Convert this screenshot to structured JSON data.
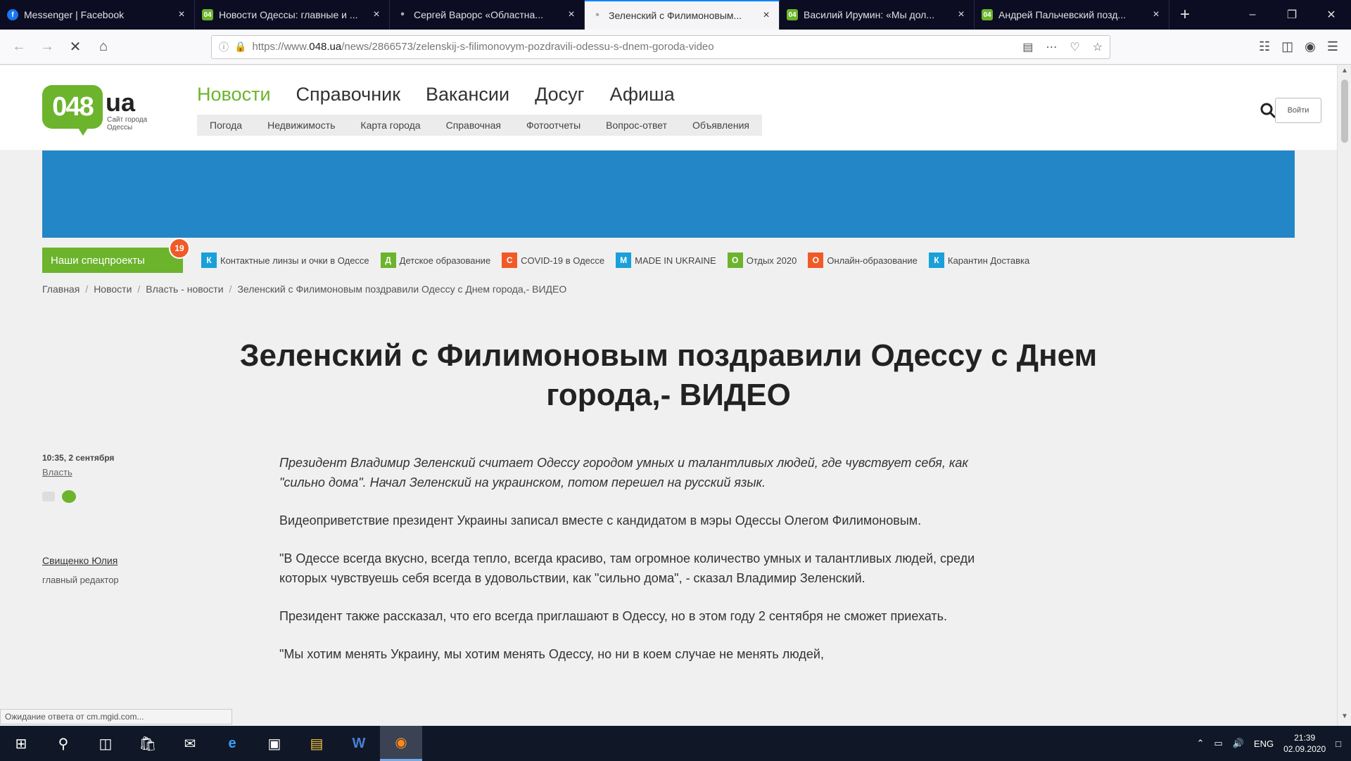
{
  "browser": {
    "tabs": [
      {
        "title": "Messenger | Facebook",
        "favicon": "facebook",
        "active": false
      },
      {
        "title": "Новости Одессы: главные и ...",
        "favicon": "048",
        "active": false
      },
      {
        "title": "Сергей Варорс «Областна...",
        "favicon": "dot",
        "active": false
      },
      {
        "title": "Зеленский с Филимоновым...",
        "favicon": "dot",
        "active": true
      },
      {
        "title": "Василий Ирумин: «Мы дол...",
        "favicon": "048",
        "active": false
      },
      {
        "title": "Андрей Пальчевский позд...",
        "favicon": "048",
        "active": false
      }
    ],
    "url_prefix": "https://www.",
    "url_domain": "048.ua",
    "url_path": "/news/2866573/zelenskij-s-filimonovym-pozdravili-odessu-s-dnem-goroda-video",
    "status_text": "Ожидание ответа от cm.mgid.com..."
  },
  "site": {
    "logo_main": "048",
    "logo_ua": "ua",
    "logo_sub": "Сайт города Одессы",
    "main_nav": [
      "Новости",
      "Справочник",
      "Вакансии",
      "Досуг",
      "Афиша"
    ],
    "sub_nav": [
      "Погода",
      "Недвижимость",
      "Карта города",
      "Справочная",
      "Фотоотчеты",
      "Вопрос-ответ",
      "Объявления"
    ],
    "login_label": "Войти"
  },
  "special": {
    "button_label": "Наши спецпроекты",
    "badge_count": "19",
    "items": [
      {
        "letter": "К",
        "color": "#1aa0d8",
        "label": "Контактные линзы и очки в Одессе"
      },
      {
        "letter": "Д",
        "color": "#6bb42c",
        "label": "Детское образование"
      },
      {
        "letter": "C",
        "color": "#f05a28",
        "label": "COVID-19 в Одессе"
      },
      {
        "letter": "M",
        "color": "#1aa0d8",
        "label": "MADE IN UKRAINE"
      },
      {
        "letter": "О",
        "color": "#6bb42c",
        "label": "Отдых 2020"
      },
      {
        "letter": "О",
        "color": "#f05a28",
        "label": "Онлайн-образование"
      },
      {
        "letter": "К",
        "color": "#1aa0d8",
        "label": "Карантин Доставка"
      }
    ]
  },
  "breadcrumb": [
    "Главная",
    "Новости",
    "Власть - новости",
    "Зеленский с Филимоновым поздравили Одессу с Днем города,- ВИДЕО"
  ],
  "article": {
    "title": "Зеленский с Филимоновым поздравили Одессу с Днем города,- ВИДЕО",
    "date": "10:35, 2 сентября",
    "category": "Власть",
    "author": "Свищенко Юлия",
    "author_role": "главный редактор",
    "paragraphs": [
      "Президент Владимир Зеленский считает Одессу городом умных и талантливых людей, где чувствует себя, как \"сильно дома\". Начал Зеленский на украинском, потом перешел на русский язык.",
      "Видеоприветствие президент Украины записал вместе с кандидатом в мэры Одессы  Олегом Филимоновым.",
      "\"В Одессе всегда вкусно, всегда тепло, всегда красиво, там огромное количество умных и талантливых людей, среди которых чувствуешь себя всегда в удовольствии, как \"сильно дома\", - сказал Владимир Зеленский.",
      "Президент также рассказал, что его всегда приглашают в Одессу, но в этом году 2 сентября не сможет приехать.",
      "\"Мы хотим менять Украину, мы хотим менять Одессу, но ни в коем случае не менять людей,"
    ]
  },
  "taskbar": {
    "lang": "ENG",
    "time": "21:39",
    "date": "02.09.2020"
  }
}
